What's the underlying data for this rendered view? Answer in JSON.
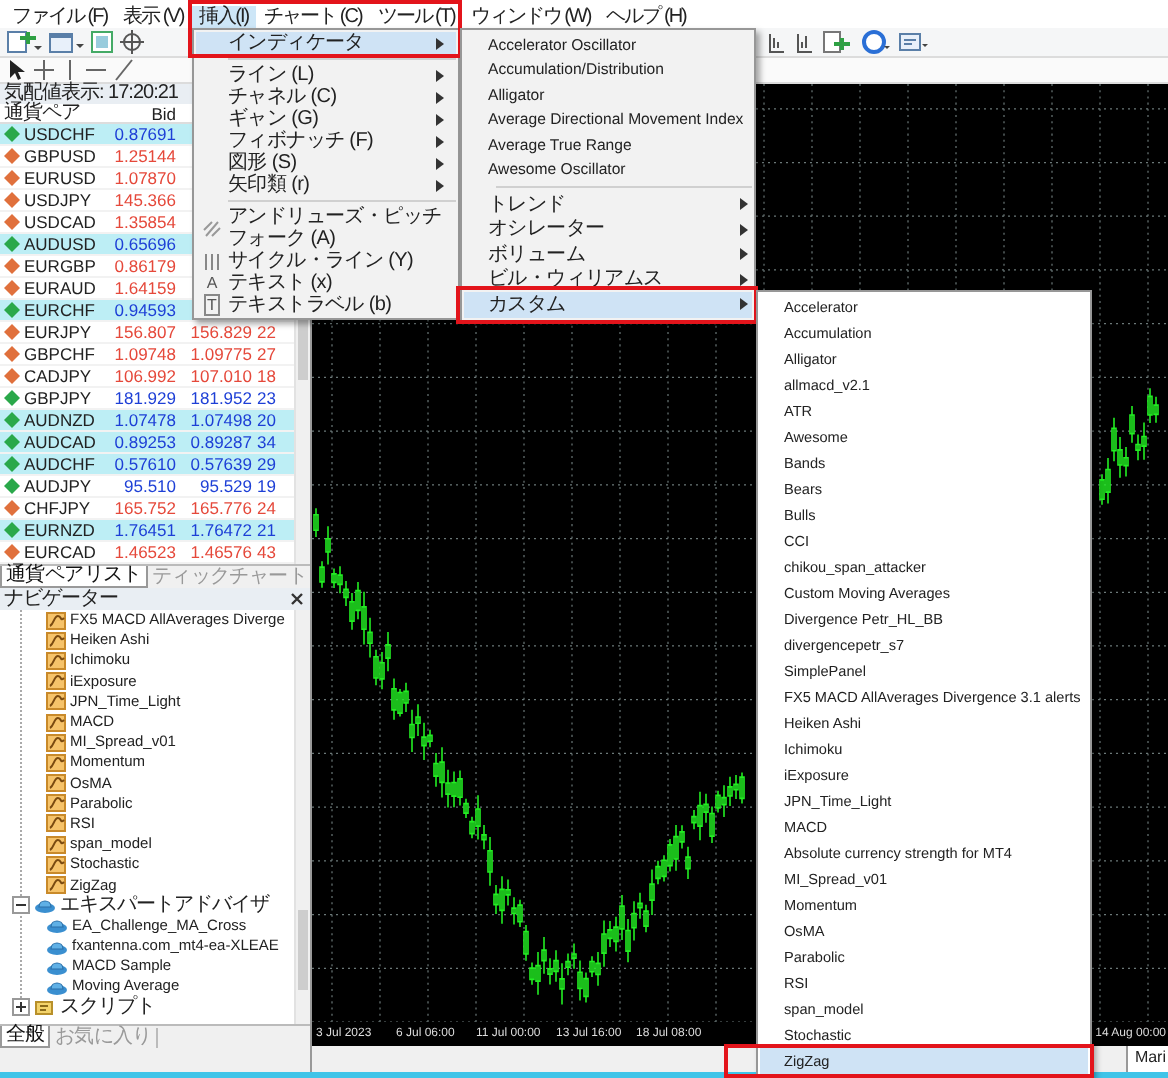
{
  "menu_bar": [
    {
      "label": "ファイル (F)",
      "selected": false
    },
    {
      "label": "表示 (V)",
      "selected": false
    },
    {
      "label": "挿入(I)",
      "selected": true
    },
    {
      "label": "チャート (C)",
      "selected": false
    },
    {
      "label": "ツール (T)",
      "selected": false
    },
    {
      "label": "ウィンドウ (W)",
      "selected": false
    },
    {
      "label": "ヘルプ (H)",
      "selected": false
    }
  ],
  "market_watch": {
    "title": "気配値表示: 17:20:21",
    "columns": [
      "通貨ペア",
      "Bid"
    ],
    "rows": [
      {
        "symbol": "USDCHF",
        "bid": "0.87691",
        "rising": true,
        "highlighted": true
      },
      {
        "symbol": "GBPUSD",
        "bid": "1.25144",
        "rising": false,
        "highlighted": false
      },
      {
        "symbol": "EURUSD",
        "bid": "1.07870",
        "rising": false,
        "highlighted": false
      },
      {
        "symbol": "USDJPY",
        "bid": "145.366",
        "rising": false,
        "highlighted": false
      },
      {
        "symbol": "USDCAD",
        "bid": "1.35854",
        "rising": false,
        "highlighted": false
      },
      {
        "symbol": "AUDUSD",
        "bid": "0.65696",
        "rising": true,
        "highlighted": true
      },
      {
        "symbol": "EURGBP",
        "bid": "0.86179",
        "rising": false,
        "highlighted": false
      },
      {
        "symbol": "EURAUD",
        "bid": "1.64159",
        "rising": false,
        "highlighted": false
      },
      {
        "symbol": "EURCHF",
        "bid": "0.94593",
        "rising": true,
        "highlighted": true
      },
      {
        "symbol": "EURJPY",
        "bid": "156.807",
        "ask": "156.829",
        "spread": "22",
        "rising": false,
        "highlighted": false
      },
      {
        "symbol": "GBPCHF",
        "bid": "1.09748",
        "ask": "1.09775",
        "spread": "27",
        "rising": false,
        "highlighted": false
      },
      {
        "symbol": "CADJPY",
        "bid": "106.992",
        "ask": "107.010",
        "spread": "18",
        "rising": false,
        "highlighted": false
      },
      {
        "symbol": "GBPJPY",
        "bid": "181.929",
        "ask": "181.952",
        "spread": "23",
        "rising": true,
        "highlighted": false
      },
      {
        "symbol": "AUDNZD",
        "bid": "1.07478",
        "ask": "1.07498",
        "spread": "20",
        "rising": true,
        "highlighted": true
      },
      {
        "symbol": "AUDCAD",
        "bid": "0.89253",
        "ask": "0.89287",
        "spread": "34",
        "rising": true,
        "highlighted": true
      },
      {
        "symbol": "AUDCHF",
        "bid": "0.57610",
        "ask": "0.57639",
        "spread": "29",
        "rising": true,
        "highlighted": true
      },
      {
        "symbol": "AUDJPY",
        "bid": "95.510",
        "ask": "95.529",
        "spread": "19",
        "rising": true,
        "highlighted": false
      },
      {
        "symbol": "CHFJPY",
        "bid": "165.752",
        "ask": "165.776",
        "spread": "24",
        "rising": false,
        "highlighted": false
      },
      {
        "symbol": "EURNZD",
        "bid": "1.76451",
        "ask": "1.76472",
        "spread": "21",
        "rising": true,
        "highlighted": true
      },
      {
        "symbol": "EURCAD",
        "bid": "1.46523",
        "ask": "1.46576",
        "spread": "43",
        "rising": false,
        "highlighted": false
      }
    ],
    "tabs": [
      {
        "label": "通貨ペアリスト",
        "selected": true
      },
      {
        "label": "ティックチャート",
        "selected": false
      }
    ]
  },
  "navigator": {
    "title": "ナビゲーター",
    "tree": [
      {
        "children": [
          {
            "label": "FX5 MACD AllAverages Diverge",
            "kind": "indicator"
          },
          {
            "label": "Heiken Ashi",
            "kind": "indicator"
          },
          {
            "label": "Ichimoku",
            "kind": "indicator"
          },
          {
            "label": "iExposure",
            "kind": "indicator"
          },
          {
            "label": "JPN_Time_Light",
            "kind": "indicator"
          },
          {
            "label": "MACD",
            "kind": "indicator"
          },
          {
            "label": "MI_Spread_v01",
            "kind": "indicator"
          },
          {
            "label": "Momentum",
            "kind": "indicator"
          },
          {
            "label": "OsMA",
            "kind": "indicator"
          },
          {
            "label": "Parabolic",
            "kind": "indicator"
          },
          {
            "label": "RSI",
            "kind": "indicator"
          },
          {
            "label": "span_model",
            "kind": "indicator"
          },
          {
            "label": "Stochastic",
            "kind": "indicator"
          },
          {
            "label": "ZigZag",
            "kind": "indicator"
          }
        ]
      },
      {
        "label": "エキスパートアドバイザ",
        "kind": "experts",
        "expanded": true,
        "children": [
          {
            "label": "EA_Challenge_MA_Cross",
            "kind": "expert"
          },
          {
            "label": "fxantenna.com_mt4-ea-XLEAE",
            "kind": "expert"
          },
          {
            "label": "MACD Sample",
            "kind": "expert"
          },
          {
            "label": "Moving Average",
            "kind": "expert"
          }
        ]
      },
      {
        "label": "スクリプト",
        "kind": "scripts",
        "expanded": false
      }
    ],
    "tabs": [
      {
        "label": "全般",
        "selected": true
      },
      {
        "label": "お気に入り",
        "selected": false
      }
    ]
  },
  "chart": {
    "time_labels": [
      "3 Jul 2023",
      "6 Jul 06:00",
      "11 Jul 00:00",
      "13 Jul 16:00",
      "18 Jul 08:00"
    ],
    "right_time_label": "14 Aug 00:00",
    "tabs": [
      {
        "label": "Mari"
      }
    ]
  },
  "insert_menu": {
    "items": [
      {
        "label": "インディケータ",
        "kind": "submenu",
        "selected": true,
        "annotated": true
      },
      {
        "kind": "separator"
      },
      {
        "label": "ライン (L)",
        "kind": "submenu",
        "selected": false,
        "annotated": false
      },
      {
        "label": "チャネル (C)",
        "kind": "submenu",
        "selected": false,
        "annotated": false
      },
      {
        "label": "ギャン (G)",
        "kind": "submenu",
        "selected": false,
        "annotated": false
      },
      {
        "label": "フィボナッチ (F)",
        "kind": "submenu",
        "selected": false,
        "annotated": false
      },
      {
        "label": "図形 (S)",
        "kind": "submenu",
        "selected": false,
        "annotated": false
      },
      {
        "label": "矢印類 (r)",
        "kind": "submenu",
        "selected": false,
        "annotated": false
      },
      {
        "kind": "separator"
      },
      {
        "label": "アンドリューズ・ピッチフォーク (A)",
        "kind": "pitchfork",
        "selected": false,
        "annotated": false
      },
      {
        "label": "サイクル・ライン (Y)",
        "kind": "cycle",
        "selected": false,
        "annotated": false
      },
      {
        "label": "テキスト (x)",
        "kind": "text",
        "glyph": "A",
        "selected": false,
        "annotated": false
      },
      {
        "label": "テキストラベル (b)",
        "kind": "label",
        "glyph": "T",
        "selected": false,
        "annotated": false
      }
    ]
  },
  "indicators_menu": {
    "items": [
      {
        "label": "Accelerator Oscillator",
        "kind": "command",
        "selected": false,
        "annotated": false
      },
      {
        "label": "Accumulation/Distribution",
        "kind": "command",
        "selected": false,
        "annotated": false
      },
      {
        "label": "Alligator",
        "kind": "command",
        "selected": false,
        "annotated": false
      },
      {
        "label": "Average Directional Movement Index",
        "kind": "command",
        "selected": false,
        "annotated": false
      },
      {
        "label": "Average True Range",
        "kind": "command",
        "selected": false,
        "annotated": false
      },
      {
        "label": "Awesome Oscillator",
        "kind": "command",
        "selected": false,
        "annotated": false
      },
      {
        "kind": "separator"
      },
      {
        "label": "トレンド",
        "kind": "submenu",
        "selected": false,
        "annotated": false
      },
      {
        "label": "オシレーター",
        "kind": "submenu",
        "selected": false,
        "annotated": false
      },
      {
        "label": "ボリューム",
        "kind": "submenu",
        "selected": false,
        "annotated": false
      },
      {
        "label": "ビル・ウィリアムス",
        "kind": "submenu",
        "selected": false,
        "annotated": false
      },
      {
        "label": "カスタム",
        "kind": "submenu",
        "selected": true,
        "annotated": true
      }
    ]
  },
  "custom_menu": {
    "items": [
      {
        "label": "Accelerator",
        "selected": false,
        "annotated": false
      },
      {
        "label": "Accumulation",
        "selected": false,
        "annotated": false
      },
      {
        "label": "Alligator",
        "selected": false,
        "annotated": false
      },
      {
        "label": "allmacd_v2.1",
        "selected": false,
        "annotated": false
      },
      {
        "label": "ATR",
        "selected": false,
        "annotated": false
      },
      {
        "label": "Awesome",
        "selected": false,
        "annotated": false
      },
      {
        "label": "Bands",
        "selected": false,
        "annotated": false
      },
      {
        "label": "Bears",
        "selected": false,
        "annotated": false
      },
      {
        "label": "Bulls",
        "selected": false,
        "annotated": false
      },
      {
        "label": "CCI",
        "selected": false,
        "annotated": false
      },
      {
        "label": "chikou_span_attacker",
        "selected": false,
        "annotated": false
      },
      {
        "label": "Custom Moving Averages",
        "selected": false,
        "annotated": false
      },
      {
        "label": "Divergence Petr_HL_BB",
        "selected": false,
        "annotated": false
      },
      {
        "label": "divergencepetr_s7",
        "selected": false,
        "annotated": false
      },
      {
        "label": "SimplePanel",
        "selected": false,
        "annotated": false
      },
      {
        "label": "FX5 MACD AllAverages Divergence 3.1 alerts",
        "selected": false,
        "annotated": false
      },
      {
        "label": "Heiken Ashi",
        "selected": false,
        "annotated": false
      },
      {
        "label": "Ichimoku",
        "selected": false,
        "annotated": false
      },
      {
        "label": "iExposure",
        "selected": false,
        "annotated": false
      },
      {
        "label": "JPN_Time_Light",
        "selected": false,
        "annotated": false
      },
      {
        "label": "MACD",
        "selected": false,
        "annotated": false
      },
      {
        "label": "Absolute currency strength for MT4",
        "selected": false,
        "annotated": false
      },
      {
        "label": "MI_Spread_v01",
        "selected": false,
        "annotated": false
      },
      {
        "label": "Momentum",
        "selected": false,
        "annotated": false
      },
      {
        "label": "OsMA",
        "selected": false,
        "annotated": false
      },
      {
        "label": "Parabolic",
        "selected": false,
        "annotated": false
      },
      {
        "label": "RSI",
        "selected": false,
        "annotated": false
      },
      {
        "label": "span_model",
        "selected": false,
        "annotated": false
      },
      {
        "label": "Stochastic",
        "selected": false,
        "annotated": false
      },
      {
        "label": "ZigZag",
        "selected": true,
        "annotated": true
      }
    ]
  }
}
